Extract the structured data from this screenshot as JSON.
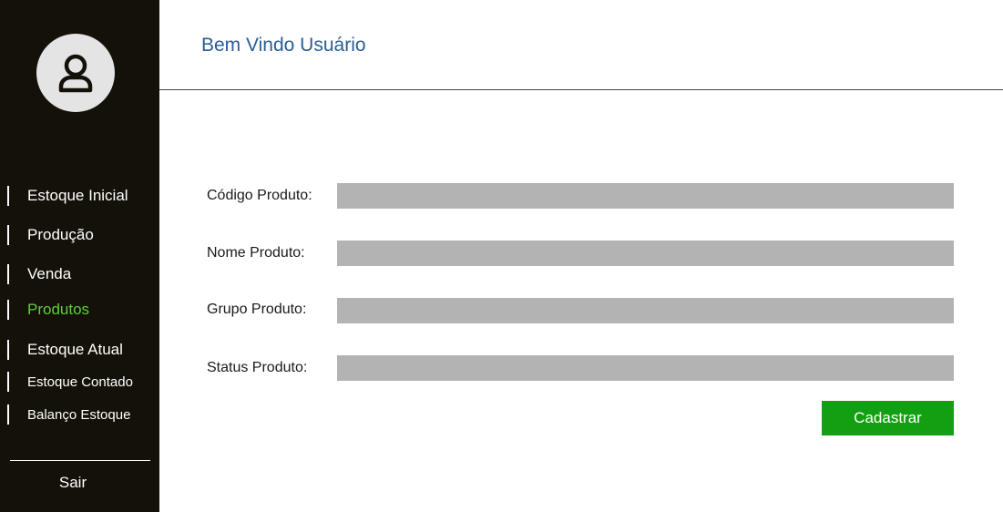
{
  "sidebar": {
    "avatar_icon": "user-icon",
    "items": [
      {
        "label": "Estoque Inicial"
      },
      {
        "label": "Produção"
      },
      {
        "label": "Venda"
      },
      {
        "label": "Produtos",
        "active": true
      },
      {
        "label": "Estoque Atual"
      },
      {
        "label": "Estoque Contado"
      },
      {
        "label": "Balanço Estoque"
      }
    ],
    "logout_label": "Sair"
  },
  "header": {
    "welcome": "Bem Vindo Usuário"
  },
  "form": {
    "fields": [
      {
        "label": "Código Produto:",
        "value": ""
      },
      {
        "label": "Nome Produto:",
        "value": ""
      },
      {
        "label": "Grupo Produto:",
        "value": ""
      },
      {
        "label": "Status Produto:",
        "value": ""
      }
    ],
    "submit_label": "Cadastrar"
  },
  "colors": {
    "sidebar_background": "#141109",
    "active_item": "#5fcf3c",
    "welcome_text": "#2a5d96",
    "input_background": "#b3b3b3",
    "submit_button": "#12a012"
  }
}
